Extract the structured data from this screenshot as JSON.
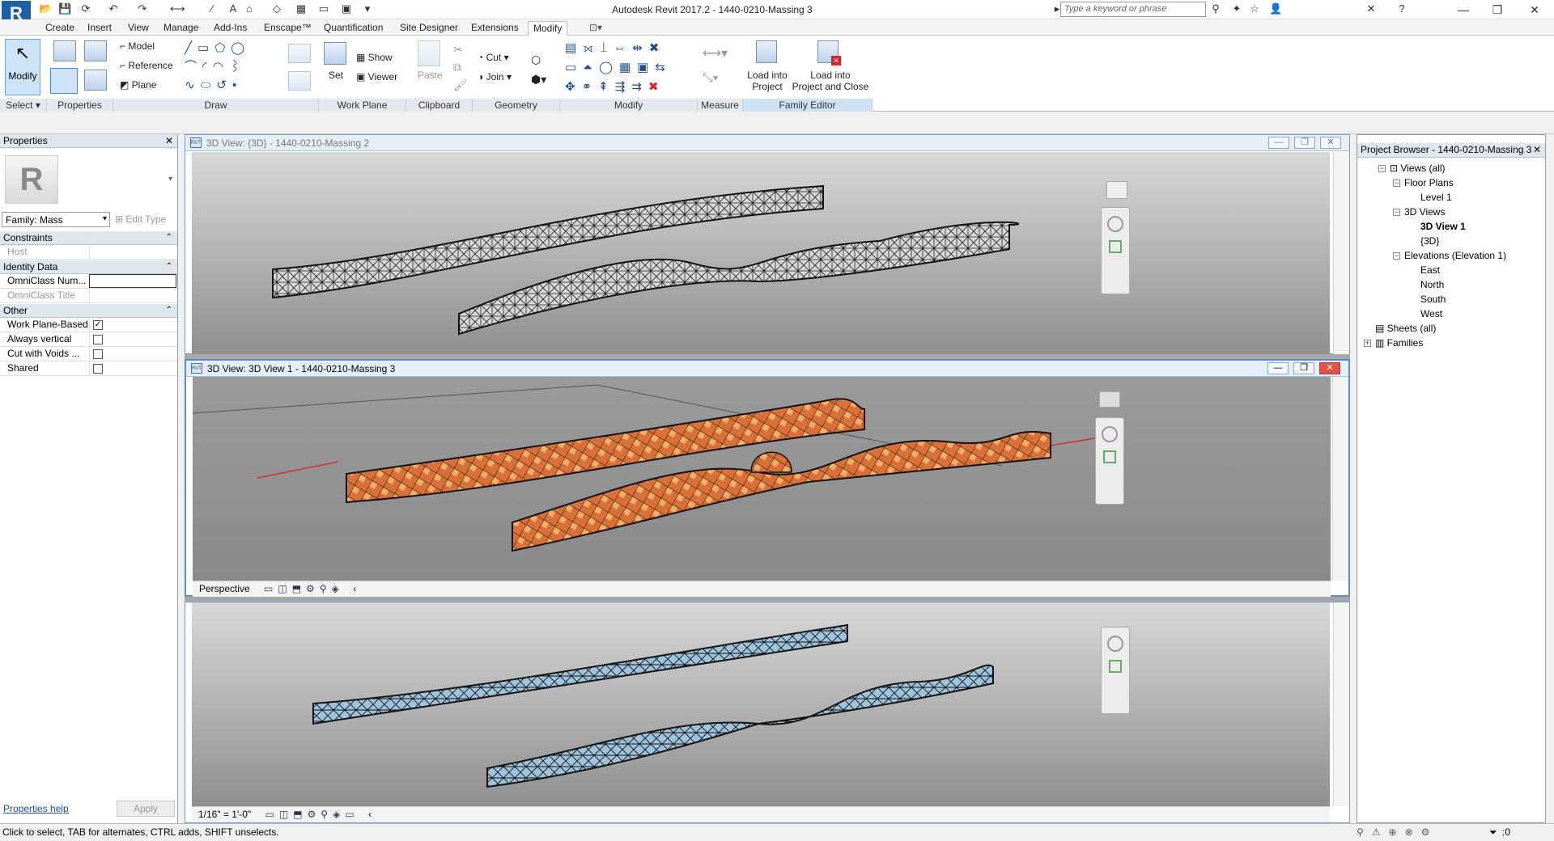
{
  "app": {
    "icon_letter": "R",
    "window_title": "Autodesk Revit 2017.2 -    1440-0210-Massing 3",
    "search_placeholder": "Type a keyword or phrase"
  },
  "tabs": [
    "Create",
    "Insert",
    "View",
    "Manage",
    "Add-Ins",
    "Enscape™",
    "Quantification",
    "Site Designer",
    "Extensions",
    "Modify"
  ],
  "active_tab": "Modify",
  "ribbon": {
    "select": {
      "modify_label": "Modify",
      "panel": "Select"
    },
    "properties_panel": "Properties",
    "draw": {
      "model": "Model",
      "reference": "Reference",
      "plane": "Plane",
      "panel": "Draw"
    },
    "work_plane": {
      "set": "Set",
      "show": "Show",
      "viewer": "Viewer",
      "panel": "Work Plane"
    },
    "clipboard": {
      "paste": "Paste",
      "panel": "Clipboard"
    },
    "geometry": {
      "cut": "Cut",
      "join": "Join",
      "panel": "Geometry"
    },
    "modify_panel": "Modify",
    "measure_panel": "Measure",
    "family_editor": {
      "load": "Load into",
      "load2": "Project",
      "load_close": "Load into",
      "load_close2": "Project and Close",
      "panel": "Family Editor"
    }
  },
  "properties": {
    "title": "Properties",
    "family_select": "Family: Mass",
    "edit_type": "Edit Type",
    "groups": [
      {
        "name": "Constraints",
        "rows": [
          {
            "key": "Host",
            "value": "",
            "gray": true
          }
        ]
      },
      {
        "name": "Identity Data",
        "rows": [
          {
            "key": "OmniClass Num...",
            "value": "",
            "input": true
          },
          {
            "key": "OmniClass Title",
            "value": "",
            "gray": true
          }
        ]
      },
      {
        "name": "Other",
        "rows": [
          {
            "key": "Work Plane-Based",
            "checked": true
          },
          {
            "key": "Always vertical",
            "checked": false
          },
          {
            "key": "Cut with Voids ...",
            "checked": false
          },
          {
            "key": "Shared",
            "checked": false
          }
        ]
      }
    ],
    "help_link": "Properties help",
    "apply": "Apply"
  },
  "views": [
    {
      "title": "3D View: {3D} - 1440-0210-Massing 2",
      "active": false
    },
    {
      "title": "3D View: 3D View 1 - 1440-0210-Massing 3",
      "active": true,
      "bottom_label": "Perspective"
    },
    {
      "title": "",
      "active": false,
      "bottom_label": "1/16\" = 1'-0\""
    }
  ],
  "browser": {
    "title": "Project Browser - 1440-0210-Massing 3",
    "items": [
      {
        "label": "Views (all)",
        "level": 0,
        "toggle": "−"
      },
      {
        "label": "Floor Plans",
        "level": 1,
        "toggle": "−"
      },
      {
        "label": "Level 1",
        "level": 2
      },
      {
        "label": "3D Views",
        "level": 1,
        "toggle": "−"
      },
      {
        "label": "3D View 1",
        "level": 2,
        "bold": true
      },
      {
        "label": "{3D}",
        "level": 2
      },
      {
        "label": "Elevations (Elevation 1)",
        "level": 1,
        "toggle": "−"
      },
      {
        "label": "East",
        "level": 2
      },
      {
        "label": "North",
        "level": 2
      },
      {
        "label": "South",
        "level": 2
      },
      {
        "label": "West",
        "level": 2
      },
      {
        "label": "Sheets (all)",
        "level": 0
      },
      {
        "label": "Families",
        "level": 0,
        "toggle": "+"
      }
    ]
  },
  "status": {
    "hint": "Click to select, TAB for alternates, CTRL adds, SHIFT unselects.",
    "filter_count": ":0"
  },
  "colors": {
    "accent": "#1f5ea8",
    "orange": "#d9703a",
    "blue_mass": "#9ec3dc"
  }
}
